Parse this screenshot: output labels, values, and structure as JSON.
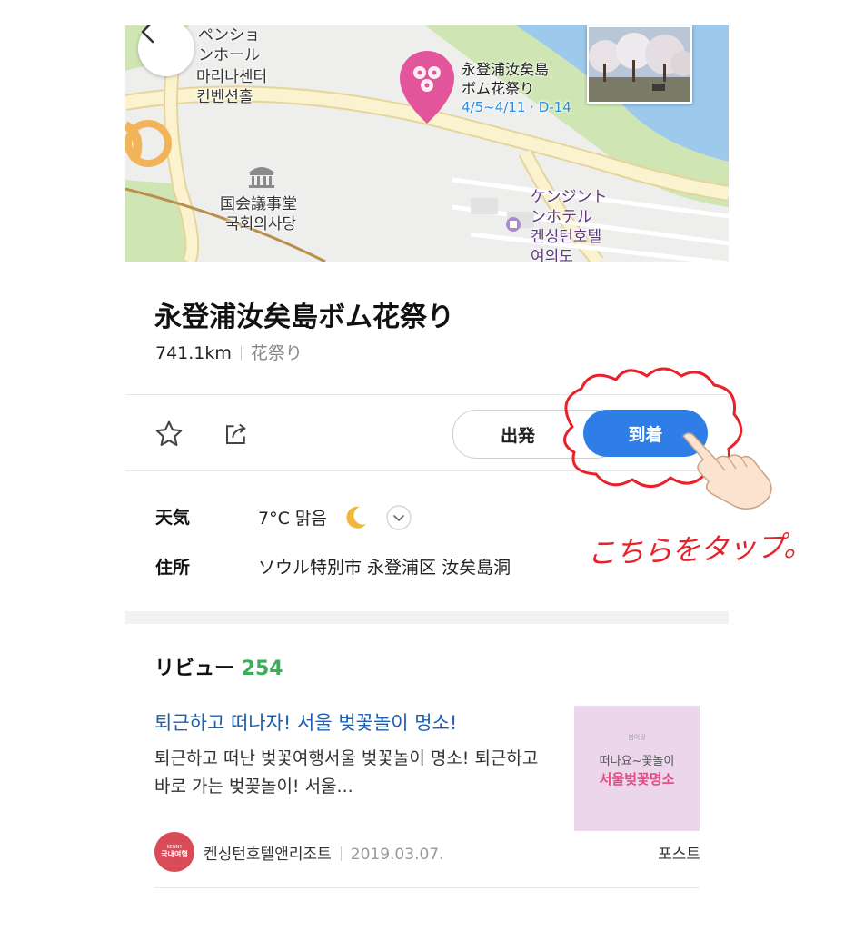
{
  "map": {
    "label_venue_ja": "ペンショ\nンホール",
    "label_venue_ko": "마리나센터\n컨벤션홀",
    "label_assembly_ja": "国会議事堂",
    "label_assembly_ko": "국회의사당",
    "label_hotel_ja": "ケンジント\nンホテル",
    "label_hotel_ko": "켄싱턴호텔\n여의도",
    "pin_title": "永登浦汝矣島\nボム花祭り",
    "pin_date": "4/5~4/11 · D-14",
    "back_icon": "chevron-left-icon",
    "colors": {
      "water": "#9cc9ec",
      "park": "#cfe6b4",
      "land": "#eeeeec",
      "road": "#fbf3cf",
      "road_edge": "#e4d59a",
      "pin": "#e3559a"
    }
  },
  "place": {
    "title": "永登浦汝矣島ボム花祭り",
    "distance": "741.1km",
    "category": "花祭り"
  },
  "actions": {
    "favorite_icon": "star-outline-icon",
    "share_icon": "share-icon",
    "depart_label": "出発",
    "arrive_label": "到着",
    "accent": "#2f7ee8"
  },
  "info": {
    "weather_label": "天気",
    "weather_value": "7°C 맑음",
    "weather_icon": "crescent-moon-icon",
    "address_label": "住所",
    "address_value": "ソウル特別市 永登浦区 汝矣島洞"
  },
  "reviews": {
    "heading": "リビュー",
    "count": "254",
    "item": {
      "title": "퇴근하고 떠나자! 서울 벚꽃놀이 명소!",
      "snippet": "퇴근하고 떠난 벚꽃여행서울 벚꽃놀이 명소! 퇴근하고 바로 가는 벚꽃놀이! 서울...",
      "thumb_small": "봄이랑",
      "thumb_line1": "떠나요~꽃놀이",
      "thumb_line2": "서울벚꽃명소",
      "avatar_line1": "KENNY",
      "avatar_line2": "국내여행",
      "author": "켄싱턴호텔앤리조트",
      "date": "2019.03.07.",
      "type": "포스트"
    }
  },
  "annotation": {
    "text": "こちらをタップ。",
    "color": "#e8212a"
  }
}
